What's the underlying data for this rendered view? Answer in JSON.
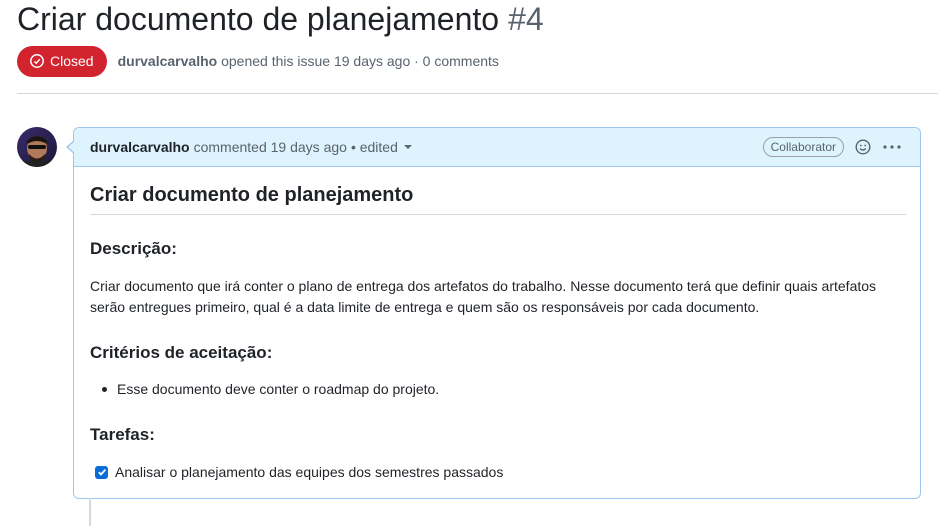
{
  "issue": {
    "title": "Criar documento de planejamento",
    "number": "#4",
    "state": "Closed",
    "author": "durvalcarvalho",
    "meta": "opened this issue 19 days ago · 0 comments"
  },
  "comment": {
    "author": "durvalcarvalho",
    "action": "commented 19 days ago",
    "edited": "• edited",
    "role_badge": "Collaborator",
    "emoji_icon": "smiley-icon",
    "more_icon": "kebab-horizontal-icon",
    "body": {
      "heading": "Criar documento de planejamento",
      "description_heading": "Descrição:",
      "description_text": "Criar documento que irá conter o plano de entrega dos artefatos do trabalho. Nesse documento terá que definir quais artefatos serão entregues primeiro, qual é a data limite de entrega e quem são os responsáveis por cada documento.",
      "criteria_heading": "Critérios de aceitação:",
      "criteria_items": [
        "Esse documento deve conter o roadmap do projeto."
      ],
      "tasks_heading": "Tarefas:",
      "tasks": [
        {
          "label": "Analisar o planejamento das equipes dos semestres passados",
          "checked": true
        }
      ]
    }
  },
  "colors": {
    "closed_badge": "#d1242f",
    "header_bg": "#ddf4ff",
    "header_border": "#9ec6f0",
    "checkbox": "#0b6cd8"
  }
}
